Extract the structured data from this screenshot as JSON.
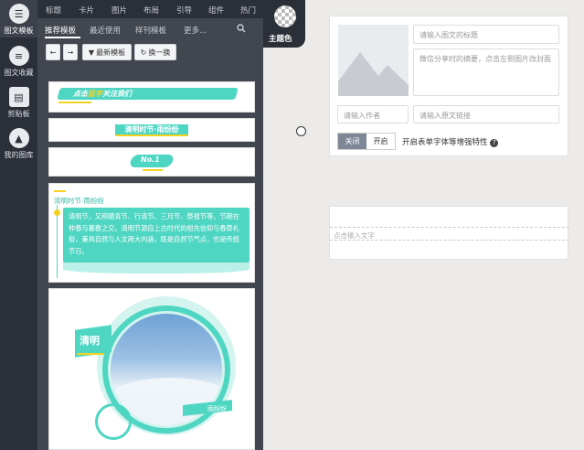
{
  "rail": {
    "items": [
      {
        "label": "图文模板"
      },
      {
        "label": "图文收藏"
      },
      {
        "label": "剪贴板"
      },
      {
        "label": "我的图库"
      }
    ]
  },
  "topnav": {
    "items": [
      "标题",
      "卡片",
      "图片",
      "布局",
      "引导",
      "组件",
      "热门"
    ]
  },
  "subnav": {
    "items": [
      "推荐模板",
      "最近使用",
      "样刊模板",
      "更多..."
    ]
  },
  "toolbar": {
    "back": "←",
    "forward": "→",
    "newest": "最新模板",
    "refresh": "换一换"
  },
  "templates": {
    "t1_text": "点击蓝字关注我们",
    "t1_highlight": "蓝字",
    "t2_text": "清明时节·雨纷纷",
    "t3_text": "No.1",
    "t4_title": "清明时节·雨纷纷",
    "t4_body": "清明节，又称踏青节、行清节、三月节、祭祖节等，节期在仲春与暮春之交。清明节源自上古时代的祖先信仰与春祭礼俗，兼具自然与人文两大内涵，既是自然节气点，也是传统节日。",
    "t5_title": "清明",
    "t5_tag": "雨纷纷"
  },
  "theme": {
    "label": "主题色"
  },
  "cover_form": {
    "title_placeholder": "请输入图文的标题",
    "summary_placeholder": "微信分享时的摘要，点击左侧图片改封面",
    "author_placeholder": "请输入作者",
    "link_placeholder": "请输入原文链接",
    "toggle_off": "关闭",
    "toggle_on": "开启",
    "toggle_desc": "开启表单字体等增强特性",
    "help": "?"
  },
  "editor": {
    "placeholder": "点击输入文字"
  },
  "colors": {
    "accent": "#4fd6c3",
    "accent_dark": "#36b8a6",
    "yellow": "#f3d224",
    "dark_bg": "#2b2f38",
    "panel_bg": "#41464f"
  }
}
